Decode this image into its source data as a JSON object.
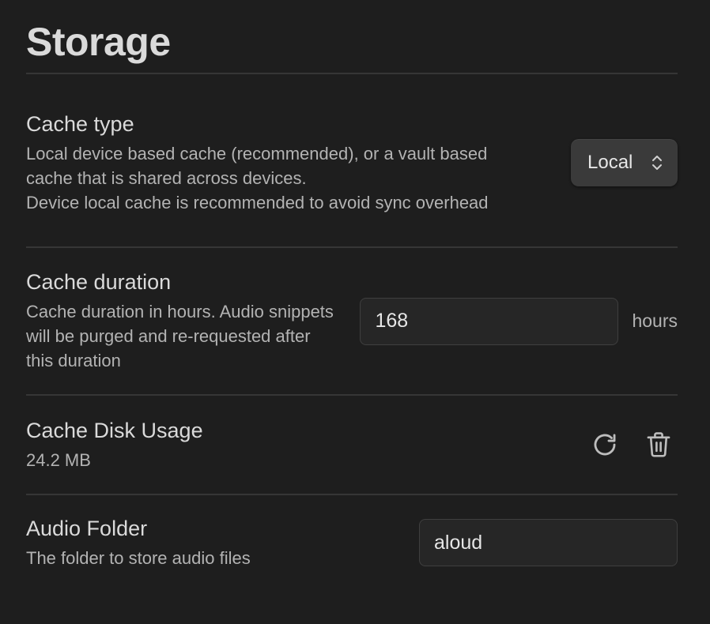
{
  "page": {
    "title": "Storage"
  },
  "settings": {
    "cache_type": {
      "name": "Cache type",
      "description_lines": [
        "Local device based cache (recommended), or a vault based cache that is shared across devices.",
        "Device local cache is recommended to avoid sync overhead"
      ],
      "selected_value": "Local",
      "icon": "chevron-up-down-icon"
    },
    "cache_duration": {
      "name": "Cache duration",
      "description": "Cache duration in hours. Audio snippets will be purged and re-requested after this duration",
      "value": "168",
      "unit": "hours"
    },
    "cache_disk_usage": {
      "name": "Cache Disk Usage",
      "usage": "24.2 MB",
      "icons": [
        "refresh-icon",
        "trash-icon"
      ]
    },
    "audio_folder": {
      "name": "Audio Folder",
      "description": "The folder to store audio files",
      "value": "aloud"
    }
  },
  "colors": {
    "background": "#1e1e1e",
    "divider": "#363636",
    "text_primary": "#dadada",
    "text_muted": "#b3b3b3",
    "select_bg": "#3a3a3a",
    "input_bg": "#262626",
    "input_border": "#3f3f3f"
  }
}
